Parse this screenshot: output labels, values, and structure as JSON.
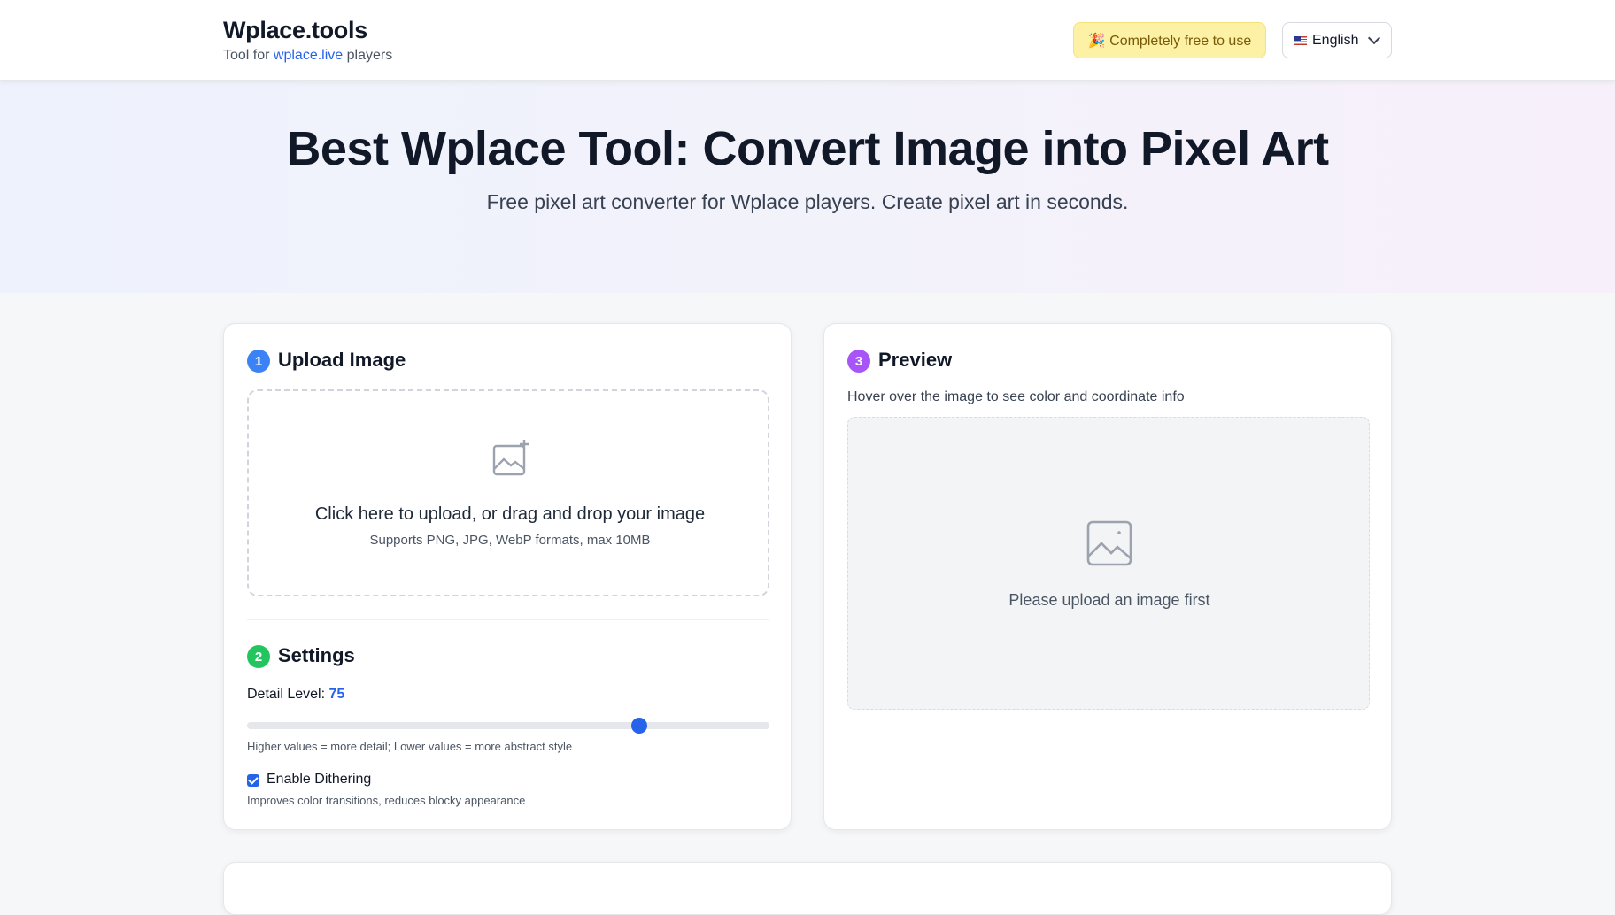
{
  "header": {
    "brand_title": "Wplace.tools",
    "brand_sub_prefix": "Tool for ",
    "brand_sub_link": "wplace.live",
    "brand_sub_suffix": " players",
    "free_badge": "🎉 Completely free to use",
    "language": "English"
  },
  "hero": {
    "title": "Best Wplace Tool: Convert Image into Pixel Art",
    "subtitle": "Free pixel art converter for Wplace players. Create pixel art in seconds."
  },
  "upload": {
    "step": "1",
    "title": "Upload Image",
    "drop_main": "Click here to upload, or drag and drop your image",
    "drop_sub": "Supports PNG, JPG, WebP formats, max 10MB",
    "icon": "image-add-icon"
  },
  "settings": {
    "step": "2",
    "title": "Settings",
    "detail_label": "Detail Level: ",
    "detail_value": "75",
    "detail_value_num": 75,
    "detail_min": 0,
    "detail_max": 100,
    "detail_hint": "Higher values = more detail; Lower values = more abstract style",
    "dither_label": "Enable Dithering",
    "dither_checked": true,
    "dither_hint": "Improves color transitions, reduces blocky appearance"
  },
  "preview": {
    "step": "3",
    "title": "Preview",
    "hint": "Hover over the image to see color and coordinate info",
    "empty": "Please upload an image first",
    "icon": "image-icon"
  },
  "colors": {
    "step1": "#3b82f6",
    "step2": "#22c55e",
    "step3": "#a855f7",
    "accent": "#2563eb"
  }
}
